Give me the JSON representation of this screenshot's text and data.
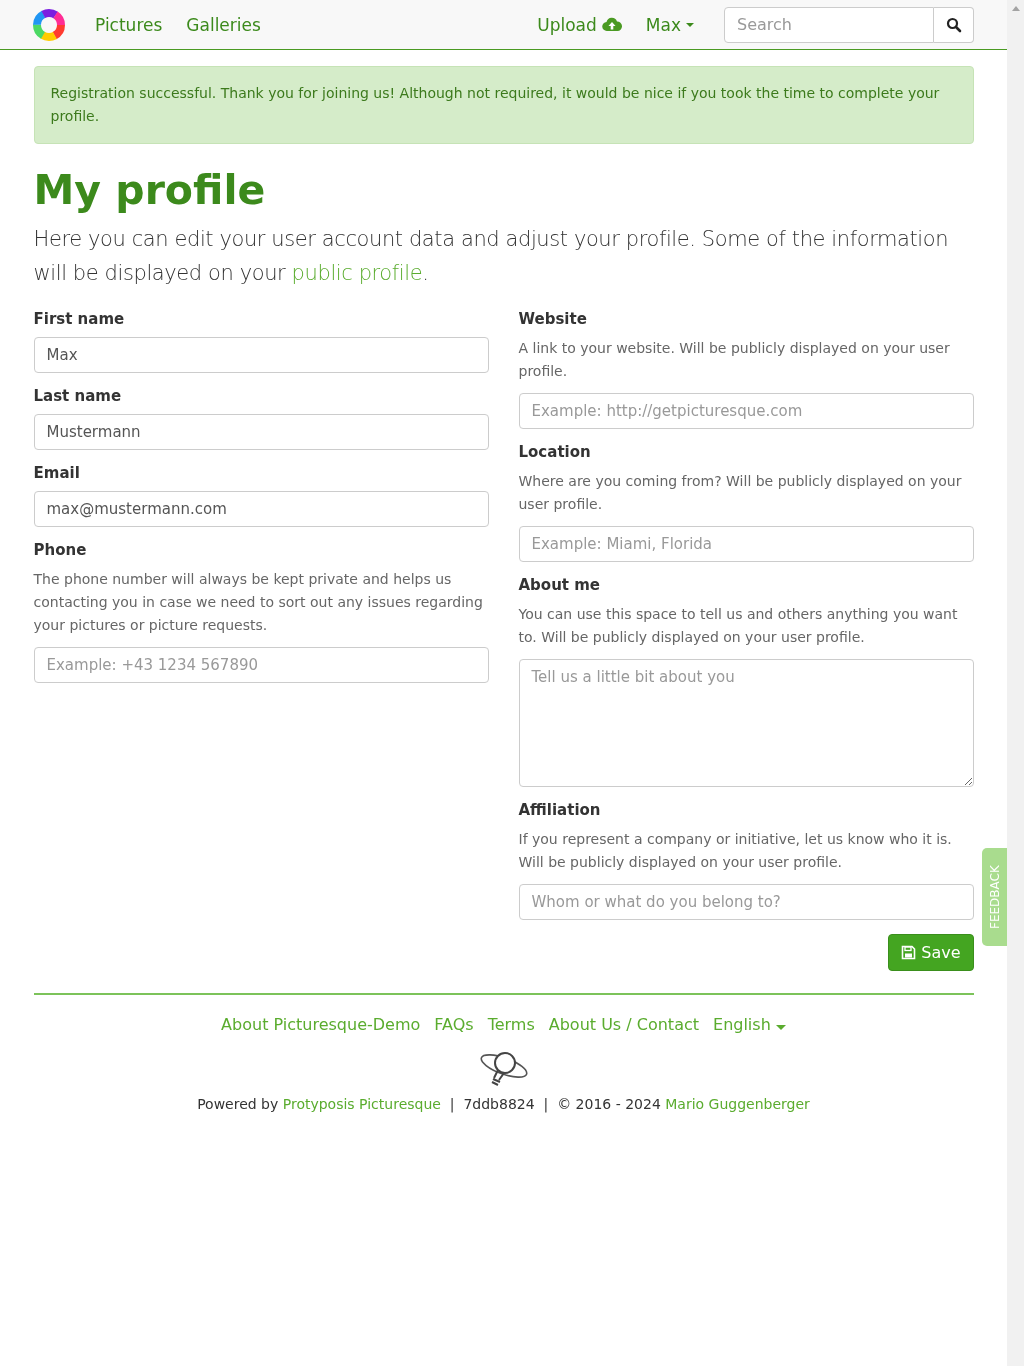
{
  "navbar": {
    "links": [
      {
        "label": "Pictures"
      },
      {
        "label": "Galleries"
      }
    ],
    "upload": {
      "label": "Upload"
    },
    "user_menu": {
      "label": "Max"
    },
    "search": {
      "placeholder": "Search"
    }
  },
  "alert": {
    "text": "Registration successful. Thank you for joining us! Although not required, it would be nice if you took the time to complete your profile."
  },
  "title": "My profile",
  "intro": {
    "before": "Here you can edit your user account data and adjust your profile. Some of the information will be displayed on your",
    "link": "public profile",
    "after": "."
  },
  "left_fields": [
    {
      "kind": "input",
      "label": "First name",
      "value": "Max"
    },
    {
      "kind": "input",
      "label": "Last name",
      "value": "Mustermann"
    },
    {
      "kind": "input",
      "label": "Email",
      "value": "max@mustermann.com"
    },
    {
      "kind": "input",
      "label": "Phone",
      "help": "The phone number will always be kept private and helps us contacting you in case we need to sort out any issues regarding your pictures or picture requests.",
      "placeholder": "Example: +43 1234 567890"
    }
  ],
  "right_fields": [
    {
      "kind": "input",
      "label": "Website",
      "help": "A link to your website. Will be publicly displayed on your user profile.",
      "placeholder": "Example: http://getpicturesque.com"
    },
    {
      "kind": "input",
      "label": "Location",
      "help": "Where are you coming from? Will be publicly displayed on your user profile.",
      "placeholder": "Example: Miami, Florida"
    },
    {
      "kind": "textarea",
      "label": "About me",
      "help": "You can use this space to tell us and others anything you want to. Will be publicly displayed on your user profile.",
      "placeholder": "Tell us a little bit about you"
    },
    {
      "kind": "input",
      "label": "Affiliation",
      "help": "If you represent a company or initiative, let us know who it is. Will be publicly displayed on your user profile.",
      "placeholder": "Whom or what do you belong to?"
    }
  ],
  "save_button": "Save",
  "feedback_tab": "FEEDBACK",
  "footer": {
    "links": [
      {
        "label": "About Picturesque-Demo"
      },
      {
        "label": "FAQs"
      },
      {
        "label": "Terms"
      },
      {
        "label": "About Us / Contact"
      }
    ],
    "language": "English",
    "powered_by": "Powered by",
    "product_link": "Protyposis Picturesque",
    "separator_1": "|",
    "version": "7ddb8824",
    "separator_2": "|",
    "copyright": "© 2016 - 2024",
    "author_link": "Mario Guggenberger"
  }
}
